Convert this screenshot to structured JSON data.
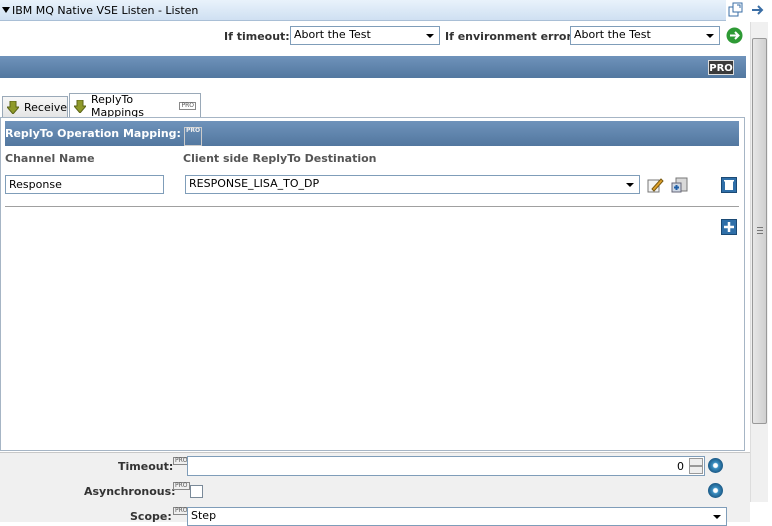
{
  "window": {
    "title": "IBM MQ Native VSE Listen - Listen"
  },
  "header": {
    "timeout_label": "If timeout:",
    "timeout_value": "Abort the Test",
    "env_error_label": "If environment error:",
    "env_error_value": "Abort the Test",
    "pro_badge": "PRO"
  },
  "tabs": [
    {
      "label": "Receive"
    },
    {
      "label": "ReplyTo Mappings",
      "badge": "PRO"
    }
  ],
  "section": {
    "title": "ReplyTo Operation Mapping:",
    "badge": "PRO"
  },
  "columns": {
    "channel_name": "Channel Name",
    "destination": "Client side ReplyTo Destination"
  },
  "mappings": [
    {
      "channel_name": "Response",
      "destination": "RESPONSE_LISA_TO_DP"
    }
  ],
  "footer": {
    "timeout_label": "Timeout:",
    "timeout_value": "0",
    "async_label": "Asynchronous:",
    "scope_label": "Scope:",
    "scope_value": "Step",
    "badge": "PRO"
  },
  "colors": {
    "accent": "#5d82aa",
    "header_bg": "#cfe0f2"
  }
}
